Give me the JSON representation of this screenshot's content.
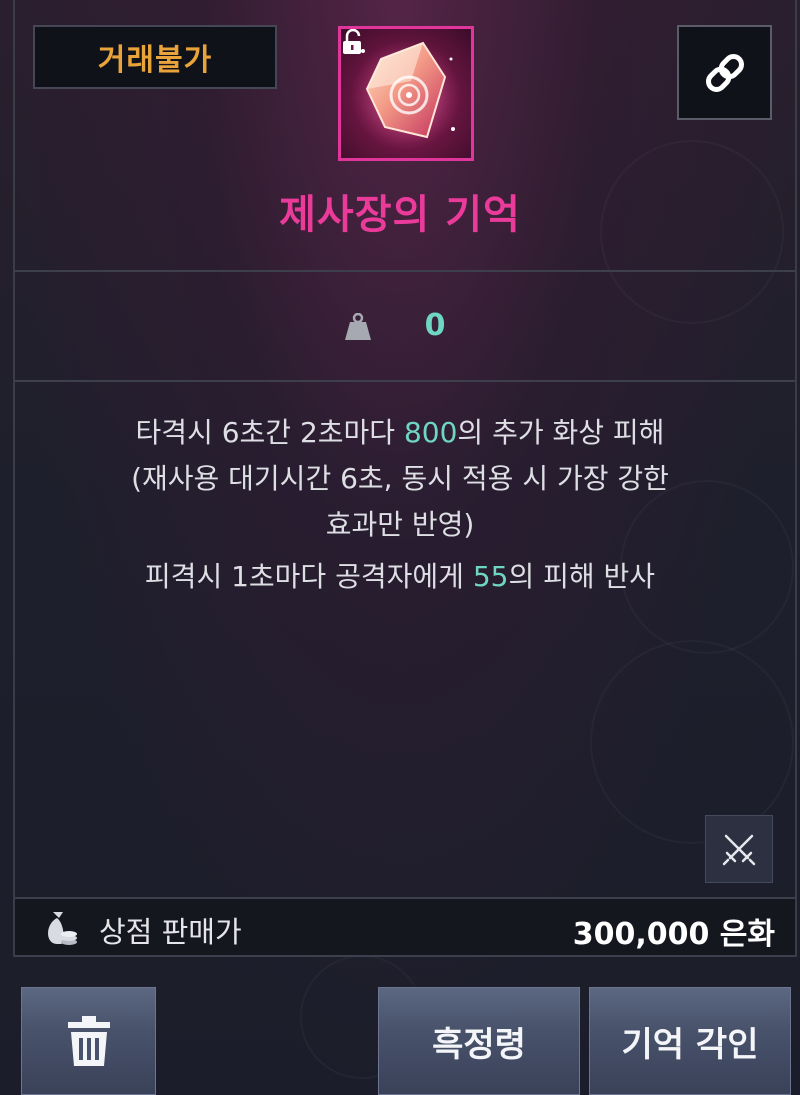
{
  "item": {
    "trade_status": "거래불가",
    "name": "제사장의 기억",
    "name_color": "#ea3b9b",
    "icon": "crystal-memory-icon",
    "lock_icon": "unlocked-padlock-icon"
  },
  "weight": {
    "icon": "weight-icon",
    "value": "0"
  },
  "description": {
    "line1_pre": "타격시 6초간 2초마다 ",
    "line1_num": "800",
    "line1_post": "의 추가 화상 피해",
    "line2": "(재사용 대기시간 6초, 동시 적용 시 가장 강한",
    "line3": "효과만 반영)",
    "line4_pre": "피격시 1초마다 공격자에게 ",
    "line4_num": "55",
    "line4_post": "의 피해 반사"
  },
  "price": {
    "icon": "money-bag-icon",
    "label": "상점 판매가",
    "value": "300,000 은화"
  },
  "buttons": {
    "link_icon": "link-icon",
    "swords_icon": "crossed-swords-icon",
    "delete_icon": "trash-icon",
    "purify": "흑정령",
    "engrave": "기억 각인"
  },
  "colors": {
    "accent_pink": "#ea3b9b",
    "trade_badge": "#e8a33a",
    "number_highlight": "#6fd6c2"
  }
}
